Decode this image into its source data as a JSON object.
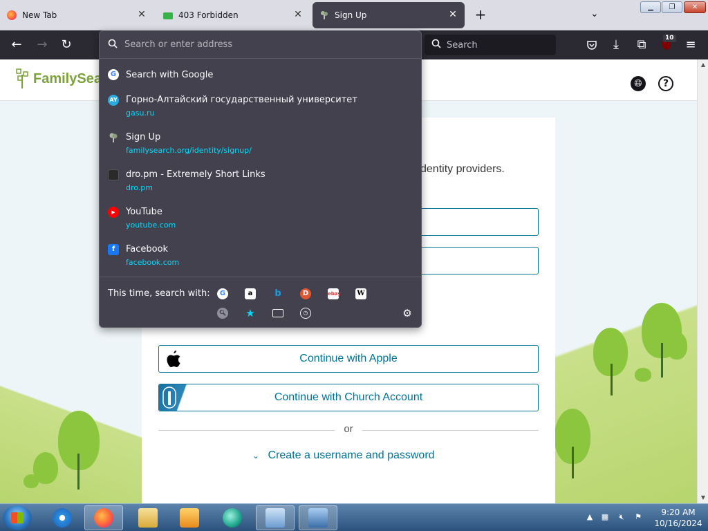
{
  "browser": {
    "tabs": [
      {
        "title": "New Tab",
        "icon": "firefox-icon"
      },
      {
        "title": "403 Forbidden",
        "icon": "folder-icon"
      },
      {
        "title": "Sign Up",
        "icon": "familysearch-tree-icon",
        "active": true
      }
    ],
    "url_placeholder": "Search or enter address",
    "search_placeholder": "Search",
    "ublock_badge": "10"
  },
  "url_dropdown": {
    "results": [
      {
        "title": "Search with Google",
        "url": "",
        "icon": "google-icon"
      },
      {
        "title": "Горно-Алтайский государственный университет",
        "url": "gasu.ru",
        "icon": "gasu-icon"
      },
      {
        "title": "Sign Up",
        "url": "familysearch.org/identity/signup/",
        "icon": "familysearch-tree-icon"
      },
      {
        "title": "dro.pm - Extremely Short Links",
        "url": "dro.pm",
        "icon": "dropm-icon"
      },
      {
        "title": "YouTube",
        "url": "youtube.com",
        "icon": "youtube-icon"
      },
      {
        "title": "Facebook",
        "url": "facebook.com",
        "icon": "facebook-icon"
      }
    ],
    "search_with_label": "This time, search with:",
    "engines": [
      "google-icon",
      "amazon-icon",
      "bing-icon",
      "duckduckgo-icon",
      "ebay-icon",
      "wikipedia-icon"
    ],
    "modes": [
      "search-icon",
      "bookmarks-star-icon",
      "tabs-icon",
      "history-clock-icon"
    ]
  },
  "page": {
    "logo_text": "FamilySearch",
    "identity_text": "dentity providers.",
    "buttons": {
      "apple": "Continue with Apple",
      "church": "Continue with Church Account"
    },
    "or_text": "or",
    "create_link": "Create a username and password"
  },
  "taskbar": {
    "time": "9:20 AM",
    "date": "10/16/2024"
  },
  "colors": {
    "browser_dark": "#2b2a33",
    "panel_bg": "#42414d",
    "url_link": "#00ddff",
    "brand_teal": "#007396",
    "familysearch_green": "#7ca33b"
  }
}
